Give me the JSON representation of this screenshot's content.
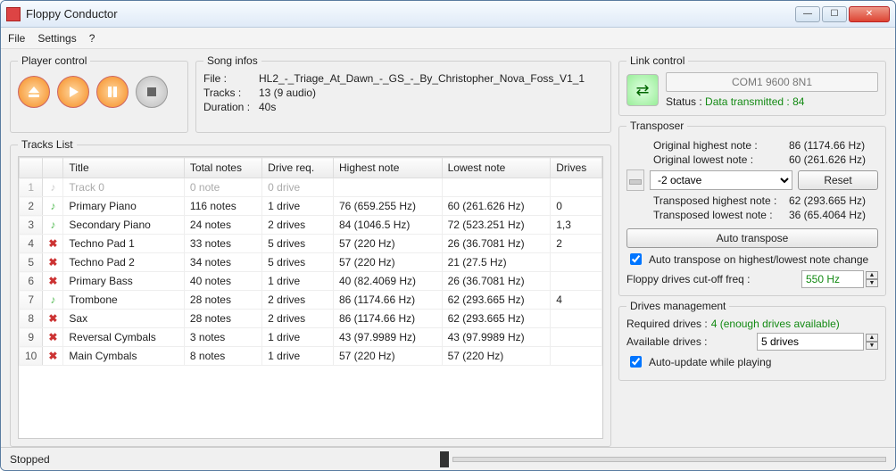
{
  "window": {
    "title": "Floppy Conductor"
  },
  "menu": {
    "file": "File",
    "settings": "Settings",
    "help": "?"
  },
  "player": {
    "legend": "Player control"
  },
  "songinfos": {
    "legend": "Song infos",
    "file_k": "File :",
    "file_v": "HL2_-_Triage_At_Dawn_-_GS_-_By_Christopher_Nova_Foss_V1_1",
    "tracks_k": "Tracks :",
    "tracks_v": "13 (9 audio)",
    "dur_k": "Duration :",
    "dur_v": "40s"
  },
  "tracks": {
    "legend": "Tracks List",
    "cols": {
      "title": "Title",
      "total": "Total notes",
      "drivereq": "Drive req.",
      "high": "Highest note",
      "low": "Lowest note",
      "drives": "Drives"
    },
    "rows": [
      {
        "n": "1",
        "icon": "dim",
        "title": "Track 0",
        "total": "0 note",
        "req": "0 drive",
        "high": "",
        "low": "",
        "drives": ""
      },
      {
        "n": "2",
        "icon": "g",
        "title": "Primary Piano",
        "total": "116 notes",
        "req": "1 drive",
        "high": "76 (659.255 Hz)",
        "low": "60 (261.626 Hz)",
        "drives": "0"
      },
      {
        "n": "3",
        "icon": "g",
        "title": "Secondary Piano",
        "total": "24 notes",
        "req": "2 drives",
        "high": "84 (1046.5 Hz)",
        "low": "72 (523.251 Hz)",
        "drives": "1,3"
      },
      {
        "n": "4",
        "icon": "x",
        "title": "Techno Pad 1",
        "total": "33 notes",
        "req": "5 drives",
        "high": "57 (220 Hz)",
        "low": "26 (36.7081 Hz)",
        "drives": "2"
      },
      {
        "n": "5",
        "icon": "x",
        "title": "Techno Pad 2",
        "total": "34 notes",
        "req": "5 drives",
        "high": "57 (220 Hz)",
        "low": "21 (27.5 Hz)",
        "drives": ""
      },
      {
        "n": "6",
        "icon": "x",
        "title": "Primary Bass",
        "total": "40 notes",
        "req": "1 drive",
        "high": "40 (82.4069 Hz)",
        "low": "26 (36.7081 Hz)",
        "drives": ""
      },
      {
        "n": "7",
        "icon": "g",
        "title": "Trombone",
        "total": "28 notes",
        "req": "2 drives",
        "high": "86 (1174.66 Hz)",
        "low": "62 (293.665 Hz)",
        "drives": "4"
      },
      {
        "n": "8",
        "icon": "x",
        "title": "Sax",
        "total": "28 notes",
        "req": "2 drives",
        "high": "86 (1174.66 Hz)",
        "low": "62 (293.665 Hz)",
        "drives": ""
      },
      {
        "n": "9",
        "icon": "x",
        "title": "Reversal Cymbals",
        "total": "3 notes",
        "req": "1 drive",
        "high": "43 (97.9989 Hz)",
        "low": "43 (97.9989 Hz)",
        "drives": ""
      },
      {
        "n": "10",
        "icon": "x",
        "title": "Main Cymbals",
        "total": "8 notes",
        "req": "1 drive",
        "high": "57 (220 Hz)",
        "low": "57 (220 Hz)",
        "drives": ""
      }
    ]
  },
  "link": {
    "legend": "Link control",
    "com": "COM1 9600 8N1",
    "status_k": "Status :",
    "status_v": "Data transmitted : 84"
  },
  "transposer": {
    "legend": "Transposer",
    "ohigh_k": "Original highest note :",
    "ohigh_v": "86 (1174.66 Hz)",
    "olow_k": "Original lowest note :",
    "olow_v": "60 (261.626 Hz)",
    "octave": "-2 octave",
    "reset": "Reset",
    "thigh_k": "Transposed highest note :",
    "thigh_v": "62 (293.665 Hz)",
    "tlow_k": "Transposed lowest note :",
    "tlow_v": "36 (65.4064 Hz)",
    "auto": "Auto transpose",
    "autochk": "Auto transpose on highest/lowest note change",
    "cutoff_k": "Floppy drives cut-off freq :",
    "cutoff_v": "550 Hz"
  },
  "drives": {
    "legend": "Drives management",
    "req_k": "Required drives :",
    "req_v": "4 (enough drives available)",
    "avail_k": "Available drives :",
    "avail_v": "5 drives",
    "autoupd": "Auto-update while playing"
  },
  "status": {
    "text": "Stopped"
  }
}
